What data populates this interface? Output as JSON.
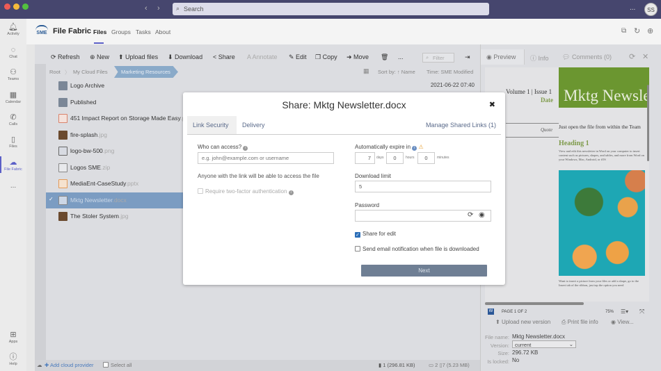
{
  "titlebar": {
    "search_placeholder": "Search",
    "more": "...",
    "avatar": "SS"
  },
  "rail": {
    "items": [
      {
        "label": "Activity",
        "icon": "bell-icon"
      },
      {
        "label": "Chat",
        "icon": "chat-icon"
      },
      {
        "label": "Teams",
        "icon": "teams-icon"
      },
      {
        "label": "Calendar",
        "icon": "calendar-icon"
      },
      {
        "label": "Calls",
        "icon": "phone-icon"
      },
      {
        "label": "Files",
        "icon": "file-icon"
      },
      {
        "label": "File Fabric",
        "icon": "cloud-icon"
      }
    ],
    "more": "...",
    "apps": "Apps",
    "help": "Help"
  },
  "header": {
    "logo_text": "SME",
    "app_name": "File Fabric",
    "tabs": [
      "Files",
      "Groups",
      "Tasks",
      "About"
    ],
    "active_tab": "Files"
  },
  "toolbar": {
    "refresh": "Refresh",
    "new": "New",
    "upload": "Upload files",
    "download": "Download",
    "share": "Share",
    "annotate": "Annotate",
    "edit": "Edit",
    "copy": "Copy",
    "move": "Move",
    "more": "...",
    "filter_placeholder": "Filter"
  },
  "breadcrumb": {
    "items": [
      "Root",
      "My Cloud Files",
      "Marketing Resources"
    ],
    "sort_label": "Sort by: ↑ Name",
    "time_label": "Time: SME Modified"
  },
  "files": [
    {
      "name": "Logo Archive",
      "ext": "",
      "type": "folder",
      "date": "2021-06-22 07:40"
    },
    {
      "name": "Published",
      "ext": "",
      "type": "folder",
      "date": ""
    },
    {
      "name": "451 Impact Report on Storage Made Easy",
      "ext": ".pdf",
      "type": "pdf",
      "date": ""
    },
    {
      "name": "fire-splash",
      "ext": ".jpg",
      "type": "image",
      "date": ""
    },
    {
      "name": "logo-bw-500",
      "ext": ".png",
      "type": "logo",
      "date": ""
    },
    {
      "name": "Logos SME",
      "ext": ".zip",
      "type": "zip",
      "date": ""
    },
    {
      "name": "MediaEnt-CaseStudy",
      "ext": ".pptx",
      "type": "pptx",
      "date": ""
    },
    {
      "name": "Mktg Newsletter",
      "ext": ".docx",
      "type": "docx",
      "date": "",
      "selected": true
    },
    {
      "name": "The Stoler System",
      "ext": ".jpg",
      "type": "image",
      "date": ""
    }
  ],
  "statusbar": {
    "add_provider": "Add cloud provider",
    "select_all": "Select all",
    "selected": "1 (296.81 KB)",
    "folders": "2",
    "files": "7 (5.23 MB)"
  },
  "modal": {
    "title": "Share: Mktg Newsletter.docx",
    "close": "✖",
    "tabs": [
      "Link Security",
      "Delivery"
    ],
    "manage_links": "Manage Shared Links (1)",
    "who_label": "Who can access?",
    "who_placeholder": "e.g. john@example.com or username",
    "anyone_text": "Anyone with the link will be able to access the file",
    "two_factor": "Require two-factor authentication",
    "expire_label": "Automatically expire in",
    "days": "7",
    "days_unit": "days",
    "hours": "0",
    "hours_unit": "hours",
    "minutes": "0",
    "minutes_unit": "minutes",
    "download_limit_label": "Download limit",
    "download_limit": "5",
    "password_label": "Password",
    "password": "",
    "share_for_edit": "Share for edit",
    "share_for_edit_checked": true,
    "email_notify": "Send email notification when file is downloaded",
    "email_notify_checked": false,
    "next": "Next"
  },
  "right": {
    "tabs": [
      "Preview",
      "Info",
      "Comments (0)"
    ],
    "doc": {
      "volume": "Volume 1 | Issue 1",
      "date": "Date",
      "banner": "Mktg Newsletter",
      "quote": "Quote",
      "intro": "Just open the file from within the Team",
      "heading": "Heading 1",
      "body": "View and edit this newsletter in Word on your computer to insert content such as pictures, shapes, and tables, and more from Word on your Windows, Mac, Android, or iOS",
      "caption": "Want to insert a picture from your files or add a shape, go to the Insert tab of the ribbon, just tap the option you need"
    },
    "page": "PAGE 1 OF 2",
    "zoom": "75%",
    "actions": {
      "upload": "Upload new version",
      "print": "Print file info",
      "view": "View..."
    },
    "info": {
      "file_name_label": "File name:",
      "file_name": "Mktg Newsletter.docx",
      "version_label": "Version:",
      "version": "current",
      "size_label": "Size:",
      "size": "296.72 KB",
      "locked_label": "Is locked:",
      "locked": "No"
    }
  },
  "colors": {
    "titlebar": "#46466e",
    "accent": "#5b5fc7",
    "selected_row": "#7b9cc2",
    "next_button": "#6f7f94",
    "banner": "#6b9630"
  }
}
